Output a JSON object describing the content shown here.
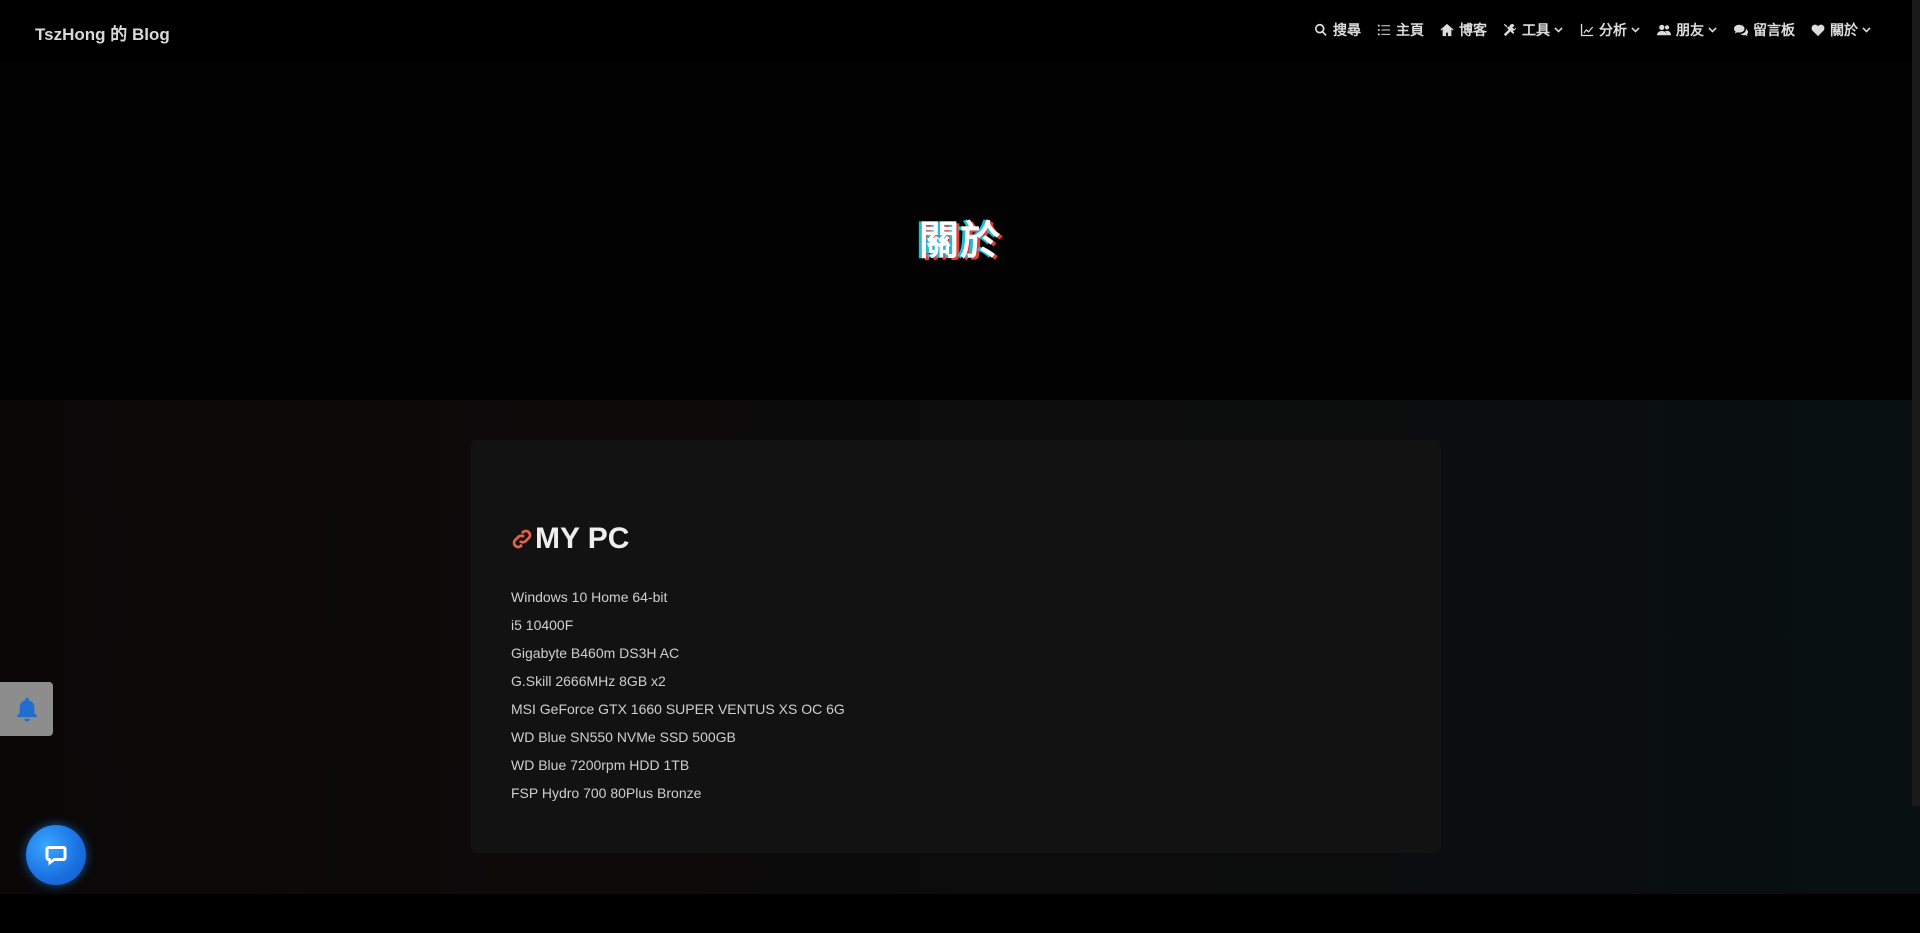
{
  "header": {
    "brand": "TszHong 的 Blog",
    "nav": [
      {
        "icon": "search-icon",
        "label": "搜尋",
        "dropdown": false
      },
      {
        "icon": "list-icon",
        "label": "主頁",
        "dropdown": false
      },
      {
        "icon": "home-icon",
        "label": "博客",
        "dropdown": false
      },
      {
        "icon": "tools-icon",
        "label": "工具",
        "dropdown": true
      },
      {
        "icon": "chart-icon",
        "label": "分析",
        "dropdown": true
      },
      {
        "icon": "users-icon",
        "label": "朋友",
        "dropdown": true
      },
      {
        "icon": "comments-icon",
        "label": "留言板",
        "dropdown": false
      },
      {
        "icon": "heart-icon",
        "label": "關於",
        "dropdown": true
      }
    ]
  },
  "hero": {
    "title": "關於"
  },
  "card": {
    "title": "MY PC",
    "link_icon_color": "#e8604c",
    "specs": [
      "Windows 10 Home 64-bit",
      "i5 10400F",
      "Gigabyte B460m DS3H AC",
      "G.Skill 2666MHz 8GB x2",
      "MSI GeForce GTX 1660 SUPER VENTUS XS OC 6G",
      "WD Blue SN550 NVMe SSD 500GB",
      "WD Blue 7200rpm HDD 1TB",
      "FSP Hydro 700 80Plus Bronze"
    ]
  },
  "widgets": {
    "bell_icon": "bell-icon",
    "chat_icon": "chat-icon",
    "accent": "#1a6fe0"
  }
}
